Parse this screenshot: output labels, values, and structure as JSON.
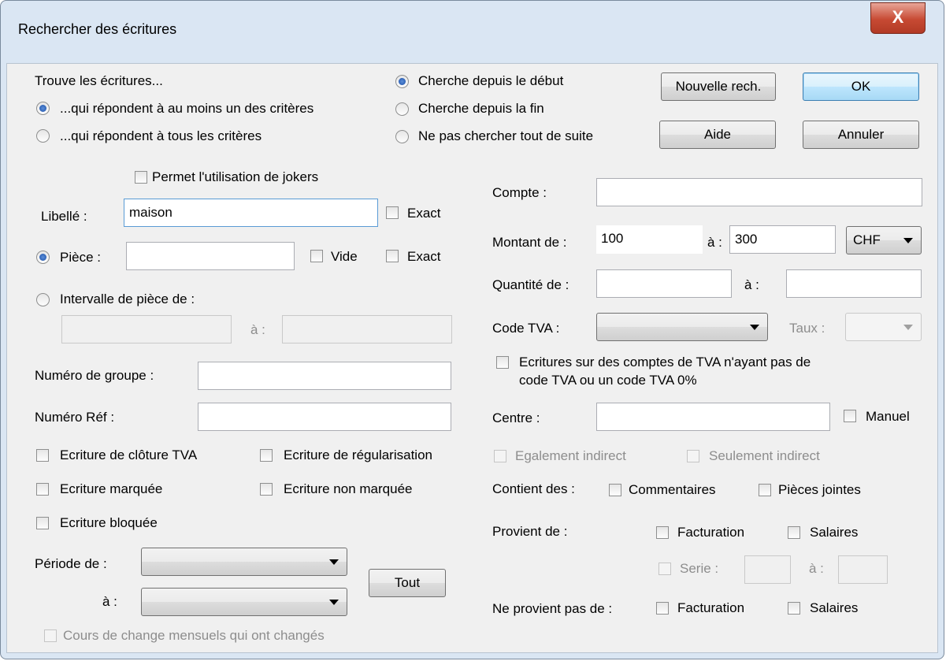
{
  "window": {
    "title": "Rechercher des écritures",
    "close_glyph": "X"
  },
  "find": {
    "heading": "Trouve les écritures...",
    "any_criteria": "...qui répondent à au moins un des critères",
    "all_criteria": "...qui répondent à tous les critères"
  },
  "search_from": {
    "beginning": "Cherche depuis le début",
    "end": "Cherche depuis la fin",
    "not_now": "Ne pas chercher tout de suite"
  },
  "buttons": {
    "new_search": "Nouvelle rech.",
    "ok": "OK",
    "help": "Aide",
    "cancel": "Annuler",
    "all": "Tout"
  },
  "left": {
    "jokers": "Permet l'utilisation de jokers",
    "libelle_label": "Libellé :",
    "libelle_value": "maison",
    "exact": "Exact",
    "piece_label": "Pièce :",
    "piece_value": "",
    "vide": "Vide",
    "interval_label": "Intervalle de pièce de :",
    "interval_to": "à :",
    "group_label": "Numéro de groupe :",
    "ref_label": "Numéro Réf :",
    "closing_vat": "Ecriture de clôture TVA",
    "regularisation": "Ecriture de régularisation",
    "marked": "Ecriture marquée",
    "unmarked": "Ecriture non marquée",
    "locked": "Ecriture bloquée",
    "period_from": "Période de :",
    "period_to": "à :",
    "exchange_rates": "Cours de change mensuels qui ont changés"
  },
  "right": {
    "account_label": "Compte :",
    "amount_label": "Montant de :",
    "amount_from": "100",
    "amount_to_label": "à :",
    "amount_to": "300",
    "currency": "CHF",
    "qty_label": "Quantité de :",
    "qty_to_label": "à :",
    "vat_code_label": "Code TVA :",
    "rate_label": "Taux :",
    "vat_accounts_line1": "Ecritures sur des comptes de TVA n'ayant pas de",
    "vat_accounts_line2": "code TVA ou un code TVA 0%",
    "center_label": "Centre :",
    "manual": "Manuel",
    "also_indirect": "Egalement indirect",
    "only_indirect": "Seulement indirect",
    "contains_label": "Contient des :",
    "comments": "Commentaires",
    "attachments": "Pièces jointes",
    "from_label": "Provient de :",
    "invoicing": "Facturation",
    "salaries": "Salaires",
    "series": "Serie :",
    "series_to": "à :",
    "not_from_label": "Ne provient pas de :",
    "not_invoicing": "Facturation",
    "not_salaries": "Salaires"
  }
}
